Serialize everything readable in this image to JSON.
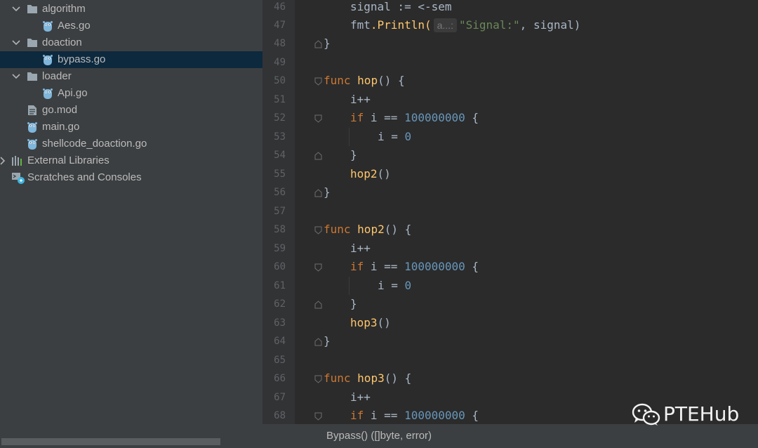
{
  "project_tree": {
    "items": [
      {
        "label": "algorithm",
        "kind": "folder",
        "expanded": true
      },
      {
        "label": "Aes.go",
        "kind": "go-file"
      },
      {
        "label": "doaction",
        "kind": "folder",
        "expanded": true
      },
      {
        "label": "bypass.go",
        "kind": "go-file",
        "selected": true
      },
      {
        "label": "loader",
        "kind": "folder",
        "expanded": true
      },
      {
        "label": "Api.go",
        "kind": "go-file"
      },
      {
        "label": "go.mod",
        "kind": "mod-file"
      },
      {
        "label": "main.go",
        "kind": "go-file"
      },
      {
        "label": "shellcode_doaction.go",
        "kind": "go-file"
      },
      {
        "label": "External Libraries",
        "kind": "libraries"
      },
      {
        "label": "Scratches and Consoles",
        "kind": "scratches"
      }
    ]
  },
  "editor": {
    "lines": [
      {
        "n": "46",
        "code": "signal := <-sem"
      },
      {
        "n": "47",
        "code": "fmt.Println(a...: \"Signal:\", signal)",
        "hint": "a...:"
      },
      {
        "n": "48",
        "code": "}"
      },
      {
        "n": "49",
        "code": ""
      },
      {
        "n": "50",
        "code": "func hop() {"
      },
      {
        "n": "51",
        "code": "i++"
      },
      {
        "n": "52",
        "code": "if i == 100000000 {"
      },
      {
        "n": "53",
        "code": "i = 0"
      },
      {
        "n": "54",
        "code": "}"
      },
      {
        "n": "55",
        "code": "hop2()"
      },
      {
        "n": "56",
        "code": "}"
      },
      {
        "n": "57",
        "code": ""
      },
      {
        "n": "58",
        "code": "func hop2() {"
      },
      {
        "n": "59",
        "code": "i++"
      },
      {
        "n": "60",
        "code": "if i == 100000000 {"
      },
      {
        "n": "61",
        "code": "i = 0"
      },
      {
        "n": "62",
        "code": "}"
      },
      {
        "n": "63",
        "code": "hop3()"
      },
      {
        "n": "64",
        "code": "}"
      },
      {
        "n": "65",
        "code": ""
      },
      {
        "n": "66",
        "code": "func hop3() {"
      },
      {
        "n": "67",
        "code": "i++"
      },
      {
        "n": "68",
        "code": "if i == 100000000 {"
      }
    ],
    "tokens": {
      "signal": "signal",
      "assign_recv": " := <-sem",
      "fmt": "fmt",
      "println": ".Println(",
      "param_hint": "a...:",
      "str_signal": "\"Signal:\"",
      "comma_signal": ", signal)",
      "close": "}",
      "func": "func",
      "hop": "hop",
      "hop2": "hop2",
      "hop3": "hop3",
      "paren_open": "() {",
      "i_inc": "i++",
      "if": "if",
      "i_eq": " i == ",
      "big_num": "100000000",
      "brace_open": " {",
      "i_assign": "i = ",
      "zero": "0",
      "call_hop2": "hop2",
      "call_hop3": "hop3",
      "call_parens": "()"
    }
  },
  "breadcrumb": {
    "text": "Bypass() ([]byte, error)"
  },
  "watermark": {
    "text": "PTEHub",
    "icon": "wechat-icon"
  },
  "colors": {
    "tree_bg": "#3c3f41",
    "editor_bg": "#2b2b2b",
    "selected_row": "#0d293e",
    "keyword": "#cc7832",
    "function": "#ffc66d",
    "number": "#6897bb",
    "string": "#6a8759"
  }
}
